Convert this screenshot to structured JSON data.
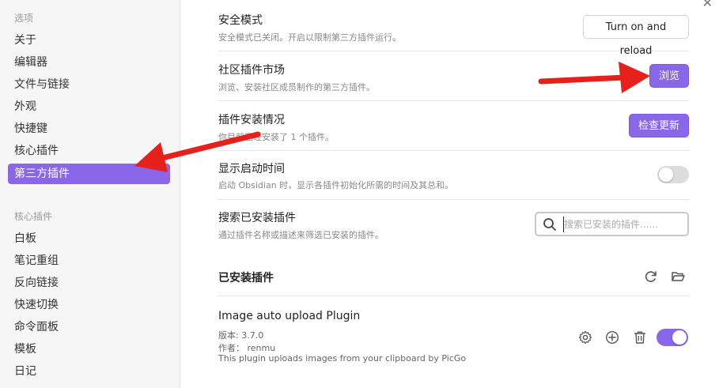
{
  "sidebar": {
    "options_heading": "选项",
    "options": [
      "关于",
      "编辑器",
      "文件与链接",
      "外观",
      "快捷键",
      "核心插件",
      "第三方插件"
    ],
    "active_index": 6,
    "core_heading": "核心插件",
    "core_plugins": [
      "白板",
      "笔记重组",
      "反向链接",
      "快速切换",
      "命令面板",
      "模板",
      "日记"
    ]
  },
  "settings": {
    "safe_mode": {
      "title": "安全模式",
      "desc": "安全模式已关闭。开启以限制第三方插件运行。",
      "button": "Turn on and reload"
    },
    "community": {
      "title": "社区插件市场",
      "desc": "浏览、安装社区成员制作的第三方插件。",
      "button": "浏览"
    },
    "installed_status": {
      "title": "插件安装情况",
      "desc": "你目前已经安装了 1 个插件。",
      "button": "检查更新"
    },
    "startup_time": {
      "title": "显示启动时间",
      "desc": "启动 Obsidian 时，显示各插件初始化所需的时间及其总和。",
      "enabled": false
    },
    "search": {
      "title": "搜索已安装插件",
      "desc": "通过插件名称或描述来筛选已安装的插件。",
      "placeholder": "搜索已安装的插件......"
    }
  },
  "installed": {
    "heading": "已安装插件",
    "plugins": [
      {
        "name": "Image auto upload Plugin",
        "version": "版本: 3.7.0",
        "author": "作者： renmu",
        "description": "This plugin uploads images from your clipboard by PicGo",
        "enabled": true
      }
    ]
  },
  "colors": {
    "accent": "#8a67e8",
    "annotation_arrow": "#e8201b"
  },
  "icons": [
    "close-icon",
    "search-icon",
    "refresh-icon",
    "folder-open-icon",
    "gear-icon",
    "plus-circle-icon",
    "trash-icon"
  ]
}
